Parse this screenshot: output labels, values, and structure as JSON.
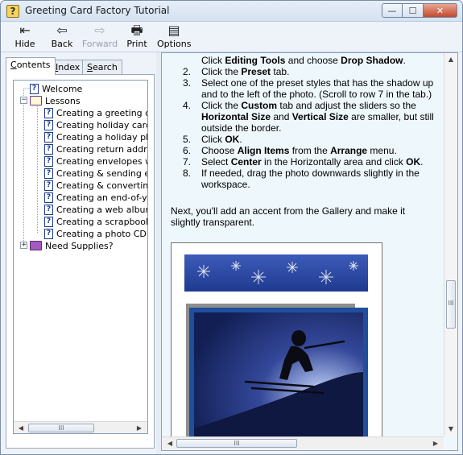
{
  "window": {
    "title": "Greeting Card Factory Tutorial",
    "icon": "help-question-icon",
    "controls": {
      "minimize": "—",
      "maximize": "☐",
      "close": "✕"
    }
  },
  "toolbar": {
    "buttons": [
      {
        "label": "Hide",
        "icon": "hide-pane-icon",
        "glyph": "⇤",
        "enabled": true
      },
      {
        "label": "Back",
        "icon": "back-arrow-icon",
        "glyph": "⇦",
        "enabled": true
      },
      {
        "label": "Forward",
        "icon": "forward-arrow-icon",
        "glyph": "⇨",
        "enabled": false
      },
      {
        "label": "Print",
        "icon": "printer-icon",
        "glyph": "🖶",
        "enabled": true
      },
      {
        "label": "Options",
        "icon": "options-icon",
        "glyph": "▤",
        "enabled": true
      }
    ]
  },
  "nav_tabs": [
    {
      "label": "Contents",
      "accesskey": "C",
      "active": true
    },
    {
      "label": "Index",
      "accesskey": "I",
      "active": false
    },
    {
      "label": "Search",
      "accesskey": "S",
      "active": false
    }
  ],
  "tree": {
    "items": [
      {
        "label": "Welcome",
        "type": "topic",
        "level": 0
      },
      {
        "label": "Lessons",
        "type": "book-open",
        "level": 0,
        "expander": "−"
      },
      {
        "label": "Creating a greeting card",
        "type": "topic",
        "level": 1
      },
      {
        "label": "Creating holiday cards fro",
        "type": "topic",
        "level": 1
      },
      {
        "label": "Creating a holiday photo",
        "type": "topic",
        "level": 1
      },
      {
        "label": "Creating return address la",
        "type": "topic",
        "level": 1
      },
      {
        "label": "Creating envelopes with",
        "type": "topic",
        "level": 1
      },
      {
        "label": "Creating & sending electr",
        "type": "topic",
        "level": 1
      },
      {
        "label": "Creating & converting a p",
        "type": "topic",
        "level": 1
      },
      {
        "label": "Creating an end-of-year c",
        "type": "topic",
        "level": 1
      },
      {
        "label": "Creating a web album (D",
        "type": "topic",
        "level": 1
      },
      {
        "label": "Creating a scrapbook ca",
        "type": "topic",
        "level": 1
      },
      {
        "label": "Creating a photo CD and",
        "type": "topic",
        "level": 1
      },
      {
        "label": "Need Supplies?",
        "type": "book-closed",
        "level": 0,
        "expander": "+"
      }
    ]
  },
  "scroll": {
    "left_arrow": "◀",
    "right_arrow": "▶",
    "up_arrow": "▲",
    "down_arrow": "▼",
    "grip": "III"
  },
  "article": {
    "steps": [
      {
        "num": "",
        "parts": [
          {
            "t": "Click "
          },
          {
            "t": "Editing Tools",
            "b": true
          },
          {
            "t": " and choose "
          },
          {
            "t": "Drop Shadow",
            "b": true
          },
          {
            "t": "."
          }
        ]
      },
      {
        "num": "2.",
        "parts": [
          {
            "t": "Click the "
          },
          {
            "t": "Preset",
            "b": true
          },
          {
            "t": " tab."
          }
        ]
      },
      {
        "num": "3.",
        "parts": [
          {
            "t": "Select one of the preset styles that has the shadow up and to the left of the photo. (Scroll to row 7 in the tab.)"
          }
        ]
      },
      {
        "num": "4.",
        "parts": [
          {
            "t": "Click the "
          },
          {
            "t": "Custom",
            "b": true
          },
          {
            "t": " tab and adjust the sliders so the "
          },
          {
            "t": "Horizontal Size",
            "b": true
          },
          {
            "t": " and "
          },
          {
            "t": "Vertical Size",
            "b": true
          },
          {
            "t": " are smaller, but still outside the border."
          }
        ]
      },
      {
        "num": "5.",
        "parts": [
          {
            "t": "Click "
          },
          {
            "t": "OK",
            "b": true
          },
          {
            "t": "."
          }
        ]
      },
      {
        "num": "6.",
        "parts": [
          {
            "t": "Choose "
          },
          {
            "t": "Align Items",
            "b": true
          },
          {
            "t": " from the "
          },
          {
            "t": "Arrange",
            "b": true
          },
          {
            "t": " menu."
          }
        ]
      },
      {
        "num": "7.",
        "parts": [
          {
            "t": "Select "
          },
          {
            "t": "Center",
            "b": true
          },
          {
            "t": " in the Horizontally area and click "
          },
          {
            "t": "OK",
            "b": true
          },
          {
            "t": "."
          }
        ]
      },
      {
        "num": "8.",
        "parts": [
          {
            "t": "If needed, drag the photo downwards slightly in the workspace."
          }
        ]
      }
    ],
    "paragraph": "Next, you'll add an accent from the Gallery and make it slightly transparent."
  },
  "colors": {
    "content_bg": "#eef7fb",
    "snowflake_band": "#2f4aa3",
    "photo_border": "#1f4f9c",
    "skier_sky": "#1a2d6b"
  }
}
